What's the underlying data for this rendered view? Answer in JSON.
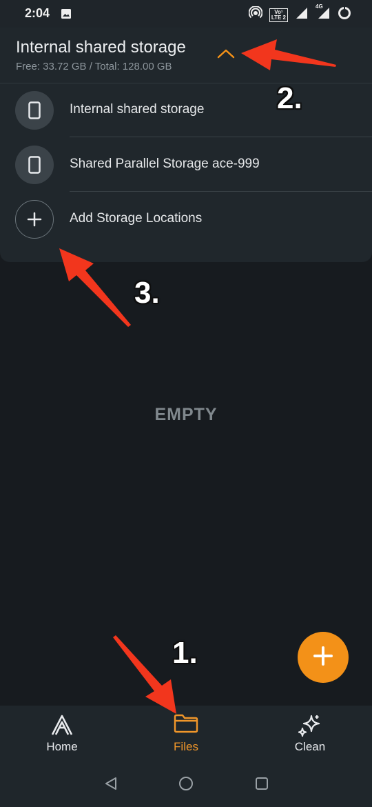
{
  "status_bar": {
    "time": "2:04",
    "volte_top": "Vo¹",
    "volte_bottom": "LTE 2",
    "net": "4G"
  },
  "header": {
    "title": "Internal shared storage",
    "subtitle": "Free: 33.72 GB / Total: 128.00 GB"
  },
  "storage_list": [
    {
      "label": "Internal shared storage",
      "icon": "phone-icon"
    },
    {
      "label": "Shared Parallel Storage ace-999",
      "icon": "phone-icon"
    },
    {
      "label": "Add Storage Locations",
      "icon": "plus-icon"
    }
  ],
  "main": {
    "empty_text": "EMPTY"
  },
  "fab": {
    "icon": "plus-icon"
  },
  "bottom_nav": [
    {
      "label": "Home",
      "icon": "app-logo-icon"
    },
    {
      "label": "Files",
      "icon": "folder-icon",
      "active": true
    },
    {
      "label": "Clean",
      "icon": "sparkle-icon"
    }
  ],
  "annotations": [
    "1.",
    "2.",
    "3."
  ],
  "colors": {
    "accent": "#f39118",
    "background": "#171b1f",
    "panel": "#20272c",
    "annotation_arrow": "#f2361d"
  }
}
